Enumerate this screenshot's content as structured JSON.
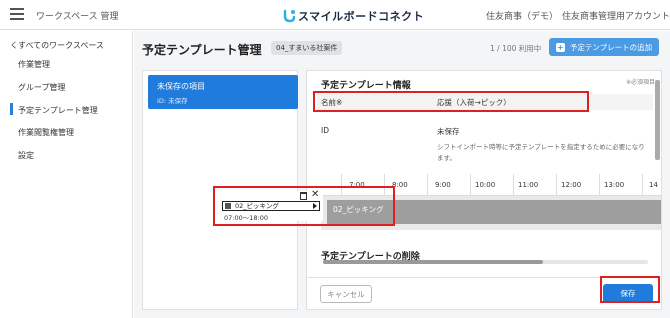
{
  "header": {
    "app_title": "ワークスペース 管理",
    "logo_text": "スマイルボードコネクト",
    "company": "住友商事（デモ）",
    "account": "住友商事管理用アカウント"
  },
  "sidebar": {
    "back": "くすべてのワークスペース",
    "items": [
      {
        "label": "作業管理"
      },
      {
        "label": "グループ管理"
      },
      {
        "label": "予定テンプレート管理"
      },
      {
        "label": "作業閲覧権管理"
      },
      {
        "label": "設定"
      }
    ]
  },
  "page": {
    "title": "予定テンプレート管理",
    "workspace_tag": "04_すまいる社案件",
    "usage": "1 / 100 利用中",
    "add_button": "予定テンプレートの追加"
  },
  "list": {
    "item_title": "未保存の項目",
    "item_id": "ID: 未保存"
  },
  "detail": {
    "section_info": "予定テンプレート情報",
    "required_note": "※必須項目",
    "name_label": "名前※",
    "name_value": "応援（入荷→ピック）",
    "id_label": "ID",
    "id_value": "未保存",
    "id_help": "シフトインポート時等に予定テンプレートを指定するために必要になります。",
    "timeline_ticks": [
      "7:00",
      "8:00",
      "9:00",
      "10:00",
      "11:00",
      "12:00",
      "13:00",
      "14"
    ],
    "timeline_bar_label": "02_ピッキング",
    "section_delete": "予定テンプレートの削除",
    "cancel": "キャンセル",
    "save": "保存"
  },
  "drag_block": {
    "label": "02_ピッキング",
    "time": "07:00〜18:00"
  },
  "colors": {
    "accent": "#1f7bdc",
    "highlight": "#e02020",
    "add_button": "#4a9be3"
  }
}
